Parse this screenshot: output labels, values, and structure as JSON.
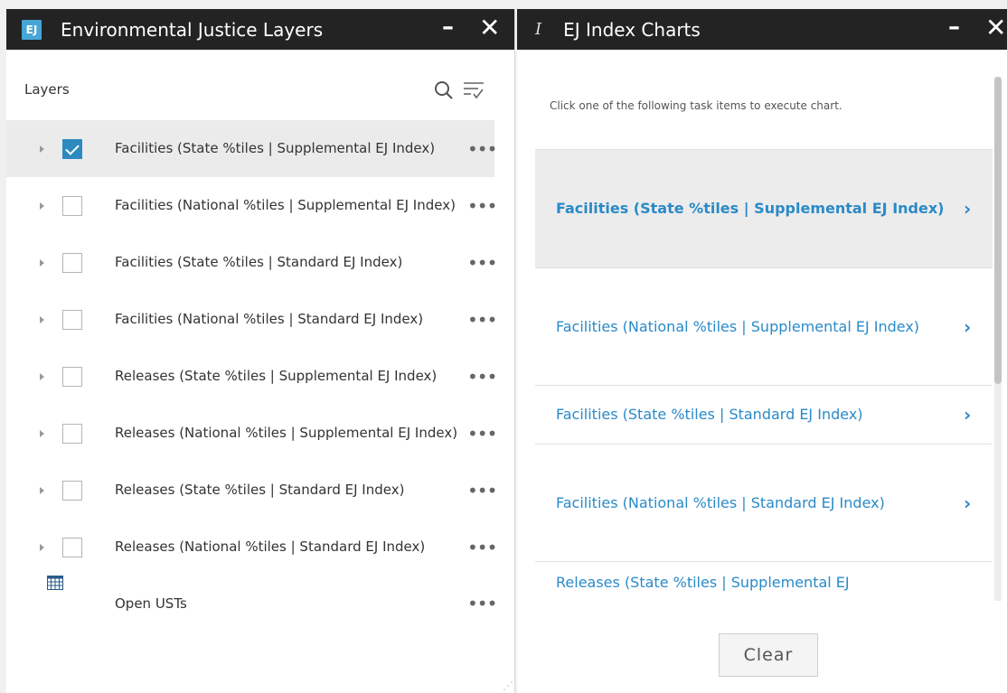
{
  "left_panel": {
    "badge": "EJ",
    "title": "Environmental Justice Layers",
    "minimize": "–",
    "close": "✕",
    "layers_label": "Layers",
    "more": "•••",
    "layers": [
      {
        "label": "Facilities (State %tiles | Supplemental EJ Index)",
        "checked": true
      },
      {
        "label": "Facilities (National %tiles | Supplemental EJ Index)",
        "checked": false
      },
      {
        "label": "Facilities (State %tiles | Standard EJ Index)",
        "checked": false
      },
      {
        "label": "Facilities (National %tiles | Standard EJ Index)",
        "checked": false
      },
      {
        "label": "Releases (State %tiles | Supplemental EJ Index)",
        "checked": false
      },
      {
        "label": "Releases (National %tiles | Supplemental EJ Index)",
        "checked": false
      },
      {
        "label": "Releases (State %tiles | Standard EJ Index)",
        "checked": false
      },
      {
        "label": "Releases (National %tiles | Standard EJ Index)",
        "checked": false
      }
    ],
    "table_layer": {
      "label": "Open USTs"
    }
  },
  "right_panel": {
    "icon": "I",
    "title": "EJ Index Charts",
    "minimize": "–",
    "close": "✕",
    "hint": "Click one of the following task items to execute chart.",
    "tasks": [
      {
        "label": "Facilities (State %tiles | Supplemental EJ Index)"
      },
      {
        "label": "Facilities (National %tiles | Supplemental EJ Index)"
      },
      {
        "label": "Facilities (State %tiles | Standard EJ Index)"
      },
      {
        "label": "Facilities (National %tiles | Standard EJ Index)"
      },
      {
        "label": "Releases (State %tiles | Supplemental EJ"
      }
    ],
    "chevron": "›",
    "clear_label": "Clear"
  },
  "colors": {
    "accent": "#2a8ac8",
    "titlebar": "#232323",
    "badge": "#46a6d8"
  }
}
